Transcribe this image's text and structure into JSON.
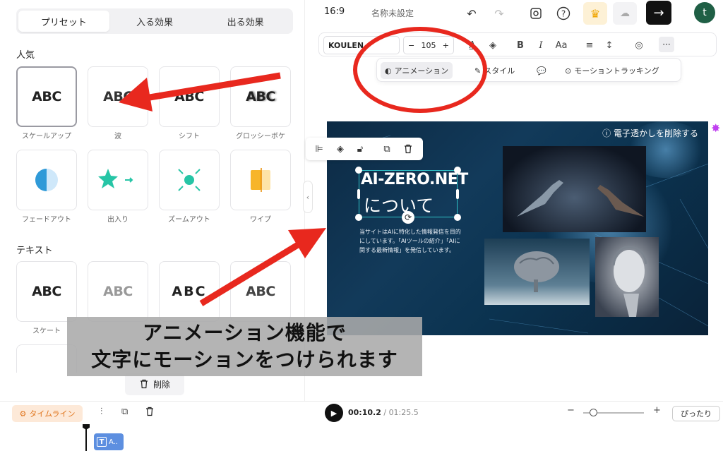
{
  "panel": {
    "tabs": [
      {
        "label": "プリセット",
        "active": true
      },
      {
        "label": "入る効果",
        "active": false
      },
      {
        "label": "出る効果",
        "active": false
      }
    ],
    "popular_title": "人気",
    "popular_items": [
      {
        "label": "スケールアップ",
        "preview": "ABC",
        "selected": true
      },
      {
        "label": "波",
        "preview": "ABC"
      },
      {
        "label": "シフト",
        "preview": "ABC"
      },
      {
        "label": "グロッシーボケ",
        "preview": "ABC"
      },
      {
        "label": "フェードアウト",
        "preview": ""
      },
      {
        "label": "出入り",
        "preview": ""
      },
      {
        "label": "ズームアウト",
        "preview": ""
      },
      {
        "label": "ワイプ",
        "preview": ""
      }
    ],
    "text_title": "テキスト",
    "text_items": [
      {
        "label": "スケート",
        "preview": "ABC"
      },
      {
        "label": "",
        "preview": "ABC"
      },
      {
        "label": "",
        "preview": "ABC"
      },
      {
        "label": "",
        "preview": "ABC"
      }
    ],
    "delete_label": "削除"
  },
  "topbar": {
    "ratio": "16:9",
    "project_title": "名称未設定",
    "avatar_letter": "t"
  },
  "toolbar": {
    "font": "KOULEN",
    "size": "105",
    "size_minus": "−",
    "size_plus": "+",
    "case_label": "Aa"
  },
  "subbar": {
    "animation_label": "アニメーション",
    "style_label": "スタイル",
    "tracking_label": "モーショントラッキング"
  },
  "canvas": {
    "watermark": "電子透かしを削除する",
    "heading_line1": "AI-ZERO.NET",
    "heading_line2": "について",
    "body_text": "当サイトはAIに特化した情報発信を目的にしています。「AIツールの紹介」「AIに関する最新情報」を発信しています。"
  },
  "timeline": {
    "label": "タイムライン",
    "current_time": "00:10.2",
    "separator": " / ",
    "total_time": "01:25.5",
    "fit_label": "ぴったり",
    "clip_label": "A.."
  },
  "caption": {
    "line1": "アニメーション機能で",
    "line2": "文字にモーションをつけられます"
  },
  "colors": {
    "accent_teal": "#2fc2c7",
    "annotation_red": "#e8281e",
    "timeline_orange": "#e0761f",
    "clip_blue": "#5d8fe0"
  }
}
